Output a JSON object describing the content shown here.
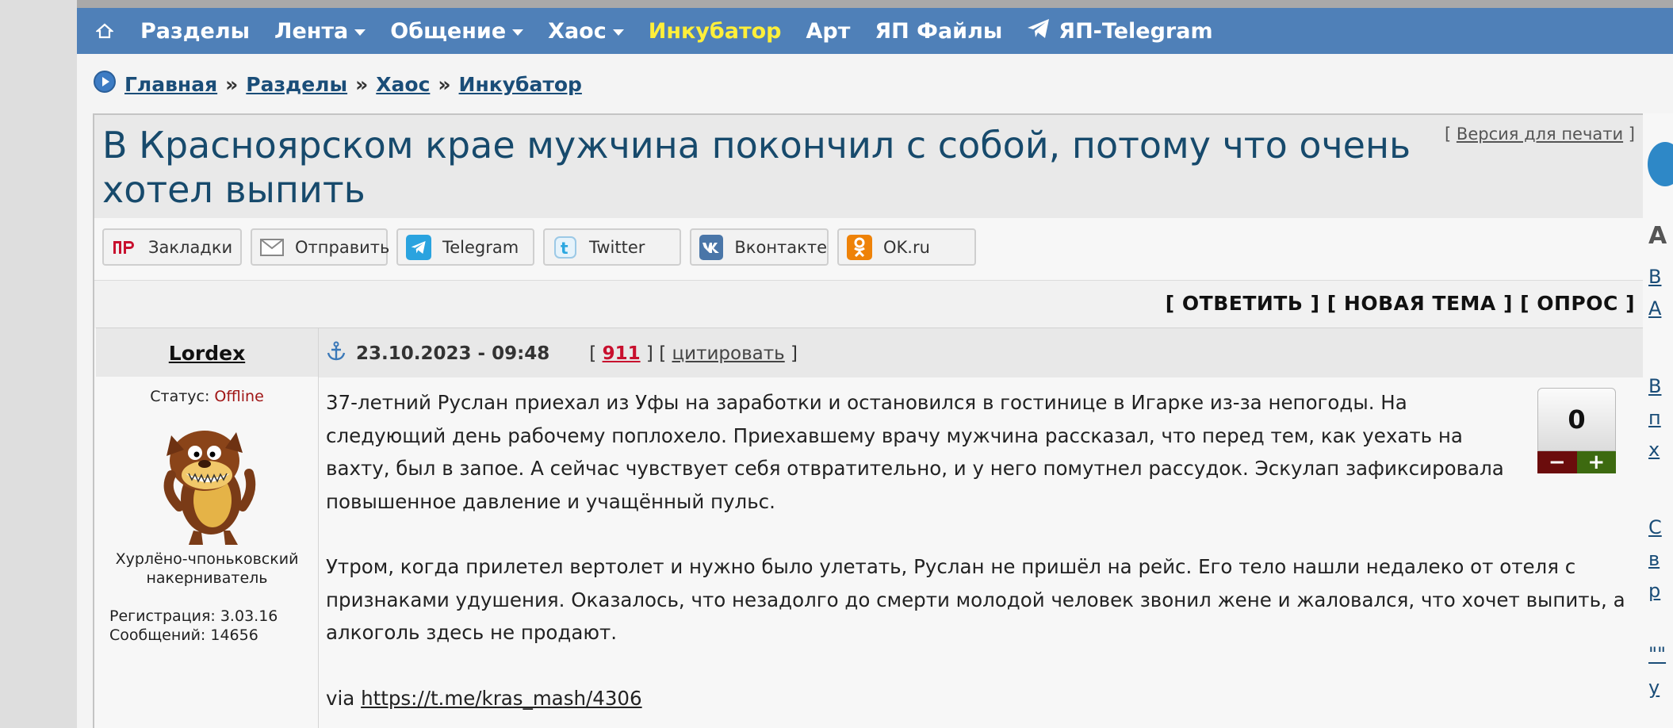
{
  "nav": {
    "home_icon": "home-icon",
    "items": [
      {
        "label": "Разделы"
      },
      {
        "label": "Лента"
      },
      {
        "label": "Общение"
      },
      {
        "label": "Хаос"
      },
      {
        "label": "Инкубатор"
      },
      {
        "label": "Арт"
      },
      {
        "label": "ЯП Файлы"
      },
      {
        "label": "ЯП-Telegram"
      }
    ]
  },
  "breadcrumb": {
    "items": [
      "Главная",
      "Разделы",
      "Хаос",
      "Инкубатор"
    ],
    "separator": "»"
  },
  "topic": {
    "title": "В Красноярском крае мужчина покончил с собой, потому что очень хотел выпить",
    "print_label": "Версия для печати",
    "share": [
      {
        "label": "Закладки",
        "icon": "yap-icon"
      },
      {
        "label": "Отправить",
        "icon": "envelope-icon"
      },
      {
        "label": "Telegram",
        "icon": "telegram-icon"
      },
      {
        "label": "Twitter",
        "icon": "twitter-icon"
      },
      {
        "label": "Вконтакте",
        "icon": "vk-icon"
      },
      {
        "label": "OK.ru",
        "icon": "ok-icon"
      }
    ],
    "actions": {
      "reply": "ОТВЕТИТЬ",
      "new_topic": "НОВАЯ ТЕМА",
      "poll": "ОПРОС"
    }
  },
  "post": {
    "author": "Lordex",
    "status_label": "Статус:",
    "status_value": "Offline",
    "rank_line1": "Хурлёно-чпоньковский",
    "rank_line2": "накерниватель",
    "registration": "Регистрация: 3.03.16",
    "messages": "Сообщений: 14656",
    "date": "23.10.2023 - 09:48",
    "post_number": "911",
    "quote_label": "цитировать",
    "rating": "0",
    "paragraphs": [
      "37-летний Руслан приехал из Уфы на заработки и остановился в гостинице в Игарке из-за непогоды. На следующий день рабочему поплохело. Приехавшему врачу мужчина рассказал, что перед тем, как уехать на вахту, был в запое. А сейчас чувствует себя отвратительно, и у него помутнел рассудок. Эскулап зафиксировала повышенное давление и учащённый пульс.",
      "Утром, когда прилетел вертолет и нужно было улетать, Руслан не пришёл на рейс. Его тело нашли недалеко от отеля с признаками удушения. Оказалось, что незадолго до смерти молодой человек звонил жене и жаловался, что хочет выпить, а алкоголь здесь не продают."
    ],
    "via_label": "via",
    "via_link": "https://t.me/kras_mash/4306"
  },
  "right_stub": [
    "А",
    "В",
    "А",
    "В",
    "п",
    "х",
    "С",
    "в",
    "р",
    "\"\"",
    "у"
  ]
}
